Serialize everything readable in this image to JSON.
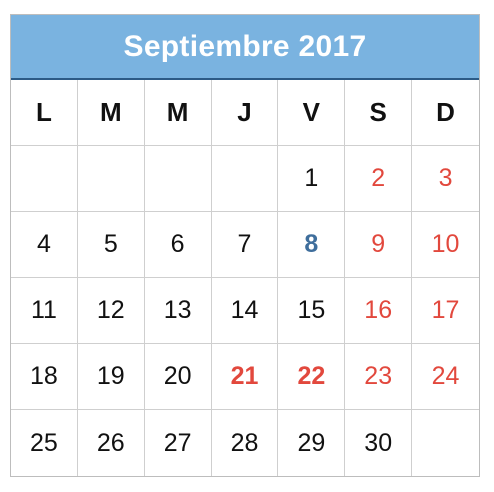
{
  "title": "Septiembre 2017",
  "weekdays": [
    "L",
    "M",
    "M",
    "J",
    "V",
    "S",
    "D"
  ],
  "days": [
    {
      "text": "",
      "style": "normal"
    },
    {
      "text": "",
      "style": "normal"
    },
    {
      "text": "",
      "style": "normal"
    },
    {
      "text": "",
      "style": "normal"
    },
    {
      "text": "1",
      "style": "normal"
    },
    {
      "text": "2",
      "style": "weekend"
    },
    {
      "text": "3",
      "style": "weekend"
    },
    {
      "text": "4",
      "style": "normal"
    },
    {
      "text": "5",
      "style": "normal"
    },
    {
      "text": "6",
      "style": "normal"
    },
    {
      "text": "7",
      "style": "normal"
    },
    {
      "text": "8",
      "style": "special"
    },
    {
      "text": "9",
      "style": "weekend"
    },
    {
      "text": "10",
      "style": "weekend"
    },
    {
      "text": "11",
      "style": "normal"
    },
    {
      "text": "12",
      "style": "normal"
    },
    {
      "text": "13",
      "style": "normal"
    },
    {
      "text": "14",
      "style": "normal"
    },
    {
      "text": "15",
      "style": "normal"
    },
    {
      "text": "16",
      "style": "weekend"
    },
    {
      "text": "17",
      "style": "weekend"
    },
    {
      "text": "18",
      "style": "normal"
    },
    {
      "text": "19",
      "style": "normal"
    },
    {
      "text": "20",
      "style": "normal"
    },
    {
      "text": "21",
      "style": "holiday"
    },
    {
      "text": "22",
      "style": "holiday"
    },
    {
      "text": "23",
      "style": "weekend"
    },
    {
      "text": "24",
      "style": "weekend"
    },
    {
      "text": "25",
      "style": "normal"
    },
    {
      "text": "26",
      "style": "normal"
    },
    {
      "text": "27",
      "style": "normal"
    },
    {
      "text": "28",
      "style": "normal"
    },
    {
      "text": "29",
      "style": "normal"
    },
    {
      "text": "30",
      "style": "normal"
    },
    {
      "text": "",
      "style": "normal"
    }
  ],
  "colors": {
    "header_background": "#7ab3e0",
    "weekend_and_holiday": "#e2483d",
    "highlight_day": "#3f6e9c"
  }
}
